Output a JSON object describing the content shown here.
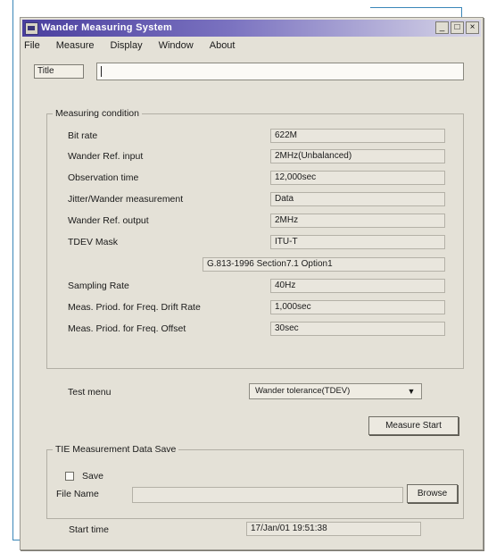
{
  "window": {
    "title": "Wander Measuring System",
    "buttons": {
      "minimize": "_",
      "maximize": "□",
      "close": "×"
    }
  },
  "menu": [
    "File",
    "Measure",
    "Display",
    "Window",
    "About"
  ],
  "title_field": {
    "label": "Title",
    "value": ""
  },
  "measuring_condition": {
    "legend": "Measuring condition",
    "rows": [
      {
        "label": "Bit rate",
        "value": "622M"
      },
      {
        "label": "Wander Ref. input",
        "value": "2MHz(Unbalanced)"
      },
      {
        "label": "Observation time",
        "value": "12,000sec"
      },
      {
        "label": "Jitter/Wander measurement",
        "value": "Data"
      },
      {
        "label": "Wander Ref. output",
        "value": "2MHz"
      },
      {
        "label": "TDEV Mask",
        "value": "ITU-T"
      },
      {
        "label": "",
        "value": "G.813-1996 Section7.1 Option1"
      },
      {
        "label": "Sampling Rate",
        "value": "40Hz"
      },
      {
        "label": "Meas. Priod. for Freq. Drift Rate",
        "value": "1,000sec"
      },
      {
        "label": "Meas. Priod. for Freq. Offset",
        "value": "30sec"
      }
    ]
  },
  "test_menu": {
    "label": "Test menu",
    "selected": "Wander tolerance(TDEV)"
  },
  "measure_start": "Measure Start",
  "tie_save": {
    "legend": "TIE Measurement Data Save",
    "save_label": "Save",
    "save_checked": false,
    "file_name_label": "File Name",
    "file_name_value": "",
    "browse": "Browse"
  },
  "start_time": {
    "label": "Start time",
    "value": "17/Jan/01 19:51:38"
  }
}
